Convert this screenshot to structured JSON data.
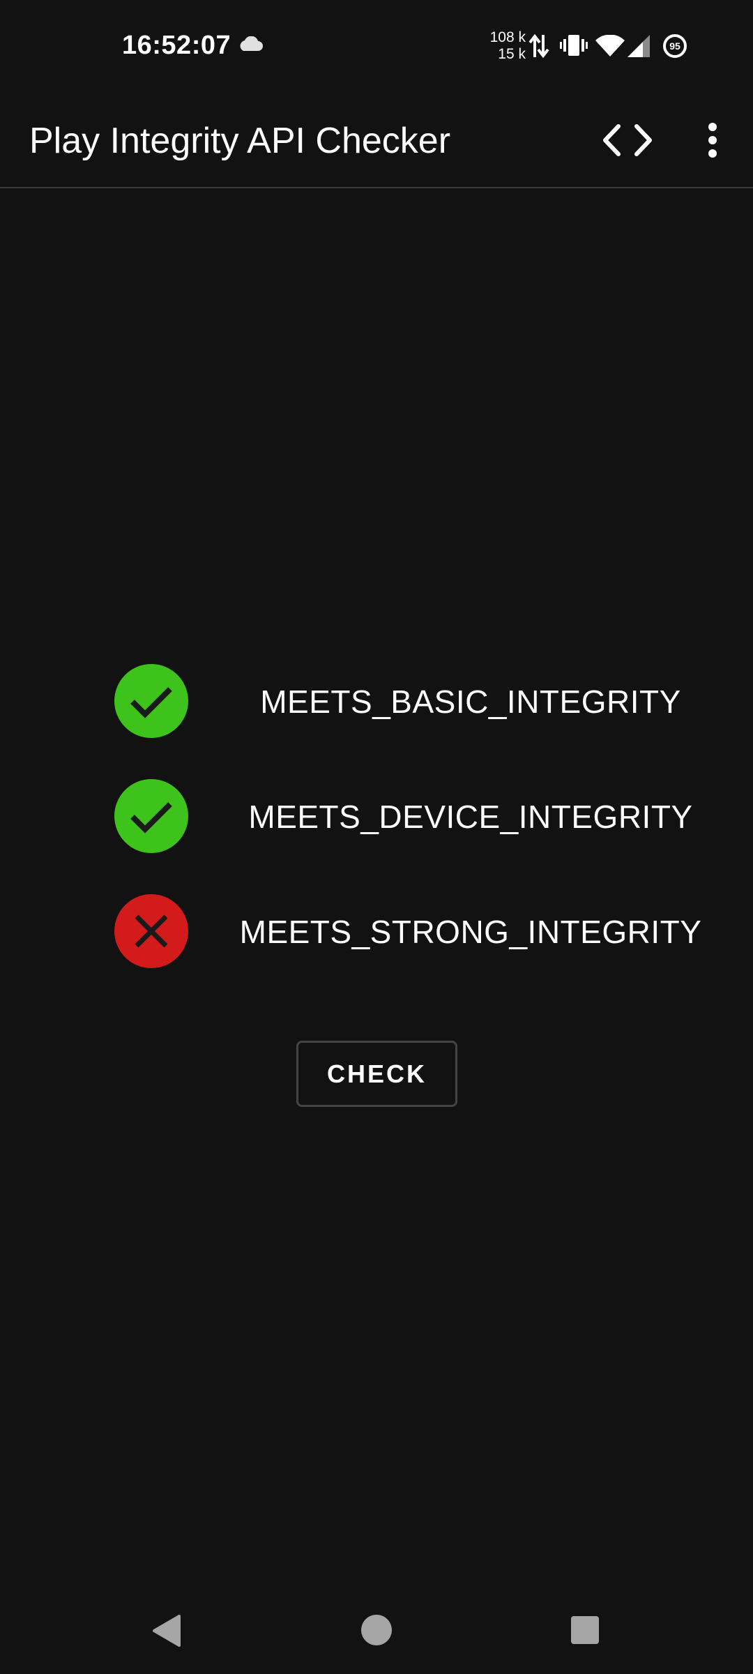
{
  "status_bar": {
    "time": "16:52:07",
    "net_speed_up": "108 k",
    "net_speed_down": "15 k",
    "battery_level": "95",
    "icons": [
      "cloud-icon",
      "data-transfer-icon",
      "vibrate-icon",
      "wifi-icon",
      "cellular-signal-icon",
      "battery-icon"
    ]
  },
  "app_bar": {
    "title": "Play Integrity API Checker",
    "actions": [
      "code-icon",
      "more-vert-icon"
    ]
  },
  "results": [
    {
      "label": "MEETS_BASIC_INTEGRITY",
      "status": "pass",
      "icon": "check-icon"
    },
    {
      "label": "MEETS_DEVICE_INTEGRITY",
      "status": "pass",
      "icon": "check-icon"
    },
    {
      "label": "MEETS_STRONG_INTEGRITY",
      "status": "fail",
      "icon": "cross-icon"
    }
  ],
  "check_button": {
    "label": "CHECK"
  },
  "nav_bar": {
    "buttons": [
      "back-icon",
      "home-icon",
      "recents-icon"
    ]
  },
  "colors": {
    "background": "#121212",
    "pass": "#3ec31c",
    "fail": "#d31b1b",
    "text": "#ffffff",
    "divider": "#3a3a3a",
    "button_border": "#444444"
  }
}
